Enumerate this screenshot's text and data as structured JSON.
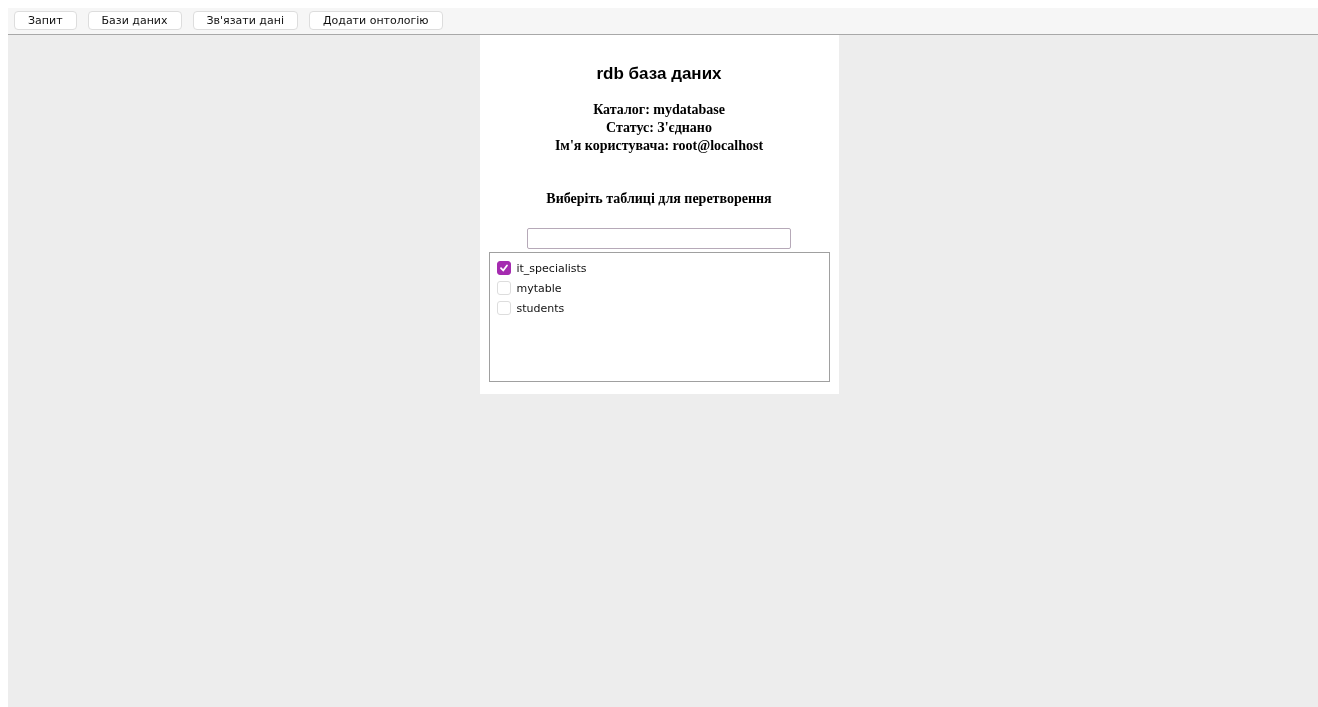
{
  "toolbar": {
    "buttons": [
      "Запит",
      "Бази даних",
      "Зв'язати дані",
      "Додати онтологію"
    ]
  },
  "panel": {
    "title": "rdb база даних",
    "info": [
      "Каталог: mydatabase",
      "Статус: З'єднано",
      "Ім'я користувача: root@localhost"
    ],
    "prompt": "Виберіть таблиці для перетворення",
    "tables": [
      {
        "label": "it_specialists",
        "checked": true
      },
      {
        "label": "mytable",
        "checked": false
      },
      {
        "label": "students",
        "checked": false
      }
    ]
  }
}
